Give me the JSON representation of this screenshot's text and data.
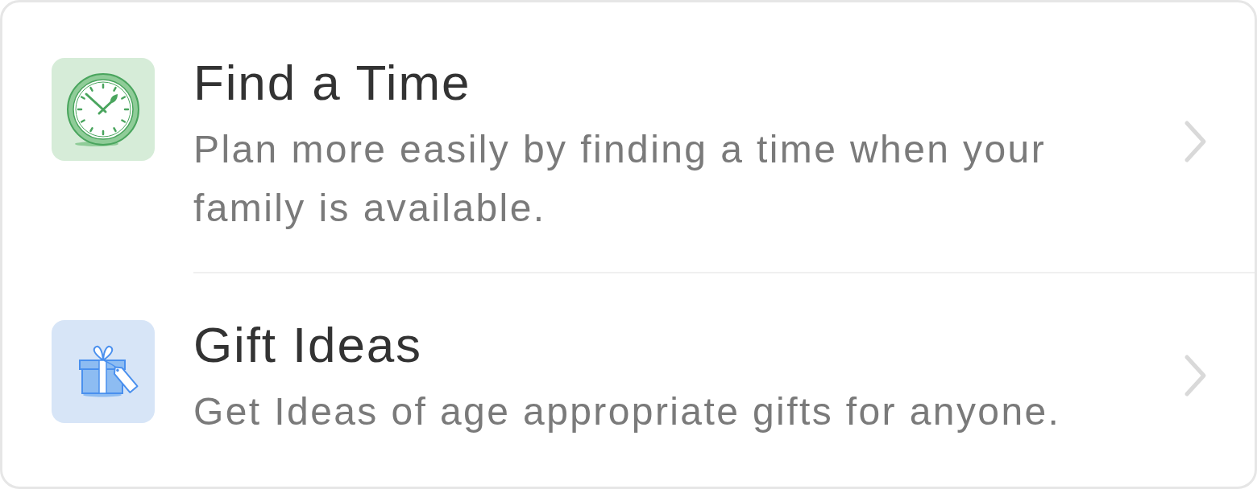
{
  "items": [
    {
      "kind": "clock",
      "title": "Find a Time",
      "description": "Plan more easily by finding a time when your family is available."
    },
    {
      "kind": "gift",
      "title": "Gift Ideas",
      "description": "Get Ideas of age appropriate gifts for anyone."
    }
  ]
}
